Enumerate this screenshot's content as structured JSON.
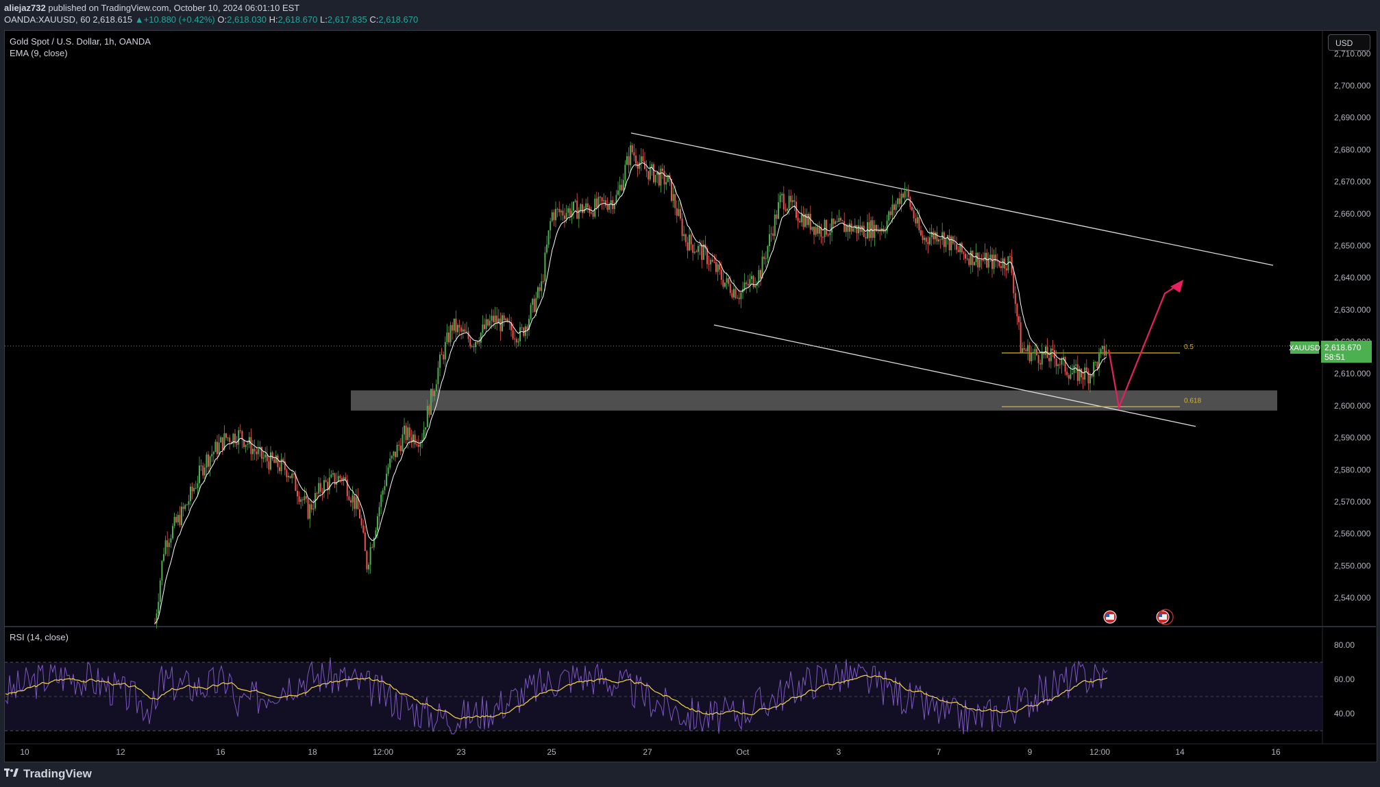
{
  "header": {
    "author": "aliejaz732",
    "published_text": "published on TradingView.com, October 10, 2024 06:01:10 EST"
  },
  "symbol_line": {
    "ticker": "OANDA:XAUUSD, 60",
    "last": "2,618.615",
    "change": "+10.880 (+0.42%)",
    "o_label": "O:",
    "o": "2,618.030",
    "h_label": "H:",
    "h": "2,618.670",
    "l_label": "L:",
    "l": "2,617.835",
    "c_label": "C:",
    "c": "2,618.670"
  },
  "legend": {
    "title": "Gold Spot / U.S. Dollar, 1h, OANDA",
    "ema": "EMA (9, close)"
  },
  "currency_button": "USD",
  "price_axis": {
    "labels": [
      "2,710.000",
      "2,700.000",
      "2,690.000",
      "2,680.000",
      "2,670.000",
      "2,660.000",
      "2,650.000",
      "2,640.000",
      "2,630.000",
      "2,620.000",
      "2,610.000",
      "2,600.000",
      "2,590.000",
      "2,580.000",
      "2,570.000",
      "2,560.000",
      "2,550.000",
      "2,540.000"
    ],
    "values": [
      2710,
      2700,
      2690,
      2680,
      2670,
      2660,
      2650,
      2640,
      2630,
      2620,
      2610,
      2600,
      2590,
      2580,
      2570,
      2560,
      2550,
      2540
    ]
  },
  "current_price": {
    "symbol": "XAUUSD",
    "price": "2,618.670",
    "countdown": "58:51",
    "value": 2618.67
  },
  "fib_levels": [
    {
      "label": "0.5",
      "value": 2616.5
    },
    {
      "label": "0.618",
      "value": 2599.7
    }
  ],
  "support_zone": {
    "low": 2598.5,
    "high": 2604.8
  },
  "time_axis": {
    "labels": [
      "10",
      "12",
      "16",
      "18",
      "12:00",
      "23",
      "25",
      "27",
      "Oct",
      "3",
      "7",
      "9",
      "12:00",
      "14",
      "16"
    ]
  },
  "rsi": {
    "legend": "RSI (14, close)",
    "labels": [
      "80.00",
      "60.00",
      "40.00"
    ],
    "values": [
      80,
      60,
      40
    ],
    "band_upper": 70,
    "band_lower": 30
  },
  "colors": {
    "up": "#26a69a",
    "bull_candle": "#4caf50",
    "bear_candle": "#ef5350",
    "ema": "#ffffff",
    "rsi_line": "#7e57c2",
    "rsi_ma": "#f5d547",
    "fib": "#d7b52c",
    "arrow": "#e91e63",
    "price_tag": "#4caf50"
  },
  "footer": {
    "brand": "TradingView",
    "logo_icon": "tradingview-logo-icon"
  }
}
